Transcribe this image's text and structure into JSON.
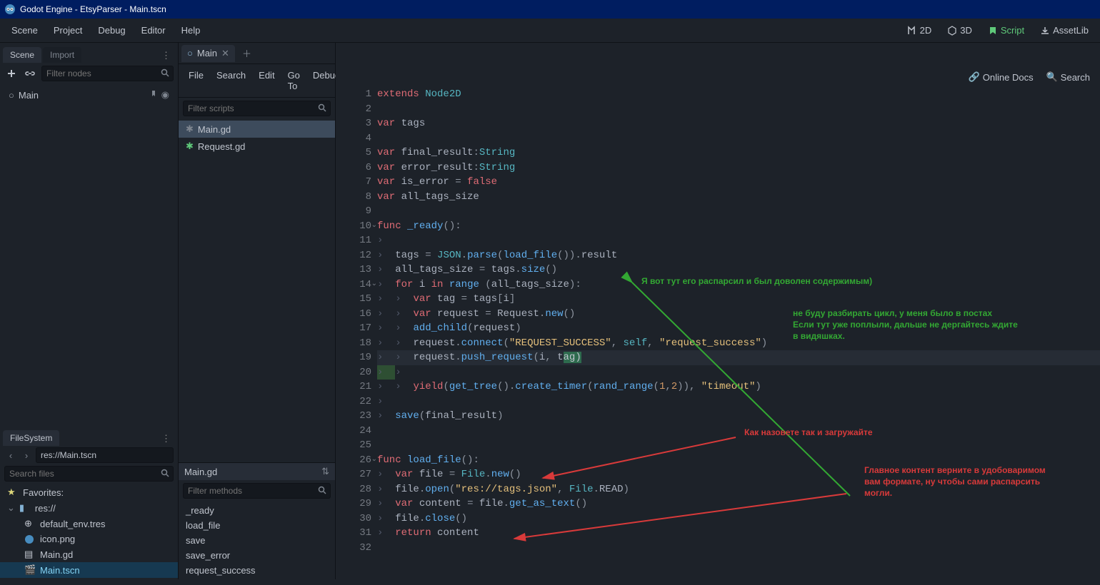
{
  "title": "Godot Engine - EtsyParser - Main.tscn",
  "topMenu": [
    "Scene",
    "Project",
    "Debug",
    "Editor",
    "Help"
  ],
  "workspaceSwitches": [
    {
      "icon": "2d",
      "label": "2D"
    },
    {
      "icon": "3d",
      "label": "3D"
    },
    {
      "icon": "script",
      "label": "Script",
      "active": true
    },
    {
      "icon": "assetlib",
      "label": "AssetLib"
    }
  ],
  "leftDock": {
    "tabs": [
      "Scene",
      "Import"
    ],
    "filterPlaceholder": "Filter nodes",
    "treeRoot": "Main"
  },
  "filesystem": {
    "title": "FileSystem",
    "path": "res://Main.tscn",
    "searchPlaceholder": "Search files",
    "favorites": "Favorites:",
    "root": "res://",
    "files": [
      "default_env.tres",
      "icon.png",
      "Main.gd",
      "Main.tscn"
    ]
  },
  "scriptTabs": {
    "open": "Main"
  },
  "scriptMenu": [
    "File",
    "Search",
    "Edit",
    "Go To",
    "Debug"
  ],
  "scriptMenuRight": [
    "Online Docs",
    "Search"
  ],
  "filterScriptsPlaceholder": "Filter scripts",
  "scripts": [
    "Main.gd",
    "Request.gd"
  ],
  "currentScript": "Main.gd",
  "filterMethodsPlaceholder": "Filter methods",
  "methods": [
    "_ready",
    "load_file",
    "save",
    "save_error",
    "request_success"
  ],
  "lines": 32,
  "annotations": {
    "a1": "Я вот тут его распарсил и был доволен содержимым)",
    "a2": "не буду разбирать цикл, у меня было в постах\nЕсли тут уже поплыли, дальше не дергайтесь ждите\nв видяшках.",
    "a3": "Как назовете так и загружайте",
    "a4": "Главное контент верните в удобоваримом\nвам формате, ну чтобы сами распарсить\nмогли."
  },
  "code": {
    "l1": [
      [
        "kw",
        "extends"
      ],
      [
        "va",
        " "
      ],
      [
        "ty",
        "Node2D"
      ]
    ],
    "l2": [],
    "l3": [
      [
        "kw",
        "var"
      ],
      [
        "va",
        " tags"
      ]
    ],
    "l4": [],
    "l5": [
      [
        "kw",
        "var"
      ],
      [
        "va",
        " final_result"
      ],
      [
        "op",
        ":"
      ],
      [
        "ty",
        "String"
      ]
    ],
    "l6": [
      [
        "kw",
        "var"
      ],
      [
        "va",
        " error_result"
      ],
      [
        "op",
        ":"
      ],
      [
        "ty",
        "String"
      ]
    ],
    "l7": [
      [
        "kw",
        "var"
      ],
      [
        "va",
        " is_error "
      ],
      [
        "op",
        "="
      ],
      [
        "va",
        " "
      ],
      [
        "kw",
        "false"
      ]
    ],
    "l8": [
      [
        "kw",
        "var"
      ],
      [
        "va",
        " all_tags_size"
      ]
    ],
    "l9": [],
    "l10": [
      [
        "kw",
        "func"
      ],
      [
        "va",
        " "
      ],
      [
        "fn",
        "_ready"
      ],
      [
        "op",
        "():"
      ]
    ],
    "l11": [
      [
        "tb",
        "›  "
      ]
    ],
    "l12": [
      [
        "tb",
        "›  "
      ],
      [
        "va",
        "tags "
      ],
      [
        "op",
        "="
      ],
      [
        "va",
        " "
      ],
      [
        "ty",
        "JSON"
      ],
      [
        "op",
        "."
      ],
      [
        "fn",
        "parse"
      ],
      [
        "op",
        "("
      ],
      [
        "fn",
        "load_file"
      ],
      [
        "op",
        "())."
      ],
      [
        "va",
        "result"
      ]
    ],
    "l13": [
      [
        "tb",
        "›  "
      ],
      [
        "va",
        "all_tags_size "
      ],
      [
        "op",
        "="
      ],
      [
        "va",
        " tags"
      ],
      [
        "op",
        "."
      ],
      [
        "fn",
        "size"
      ],
      [
        "op",
        "()"
      ]
    ],
    "l14": [
      [
        "tb",
        "›  "
      ],
      [
        "kw",
        "for"
      ],
      [
        "va",
        " i "
      ],
      [
        "kw",
        "in"
      ],
      [
        "va",
        " "
      ],
      [
        "fn",
        "range"
      ],
      [
        "va",
        " "
      ],
      [
        "op",
        "("
      ],
      [
        "va",
        "all_tags_size"
      ],
      [
        "op",
        "):"
      ]
    ],
    "l15": [
      [
        "tb",
        "›  "
      ],
      [
        "tb",
        "›  "
      ],
      [
        "kw",
        "var"
      ],
      [
        "va",
        " tag "
      ],
      [
        "op",
        "="
      ],
      [
        "va",
        " tags"
      ],
      [
        "op",
        "["
      ],
      [
        "va",
        "i"
      ],
      [
        "op",
        "]"
      ]
    ],
    "l16": [
      [
        "tb",
        "›  "
      ],
      [
        "tb",
        "›  "
      ],
      [
        "kw",
        "var"
      ],
      [
        "va",
        " request "
      ],
      [
        "op",
        "="
      ],
      [
        "va",
        " Request"
      ],
      [
        "op",
        "."
      ],
      [
        "fn",
        "new"
      ],
      [
        "op",
        "()"
      ]
    ],
    "l17": [
      [
        "tb",
        "›  "
      ],
      [
        "tb",
        "›  "
      ],
      [
        "fn",
        "add_child"
      ],
      [
        "op",
        "("
      ],
      [
        "va",
        "request"
      ],
      [
        "op",
        ")"
      ]
    ],
    "l18": [
      [
        "tb",
        "›  "
      ],
      [
        "tb",
        "›  "
      ],
      [
        "va",
        "request"
      ],
      [
        "op",
        "."
      ],
      [
        "fn",
        "connect"
      ],
      [
        "op",
        "("
      ],
      [
        "str",
        "\"REQUEST_SUCCESS\""
      ],
      [
        "op",
        ", "
      ],
      [
        "sl",
        "self"
      ],
      [
        "op",
        ", "
      ],
      [
        "str",
        "\"request_success\""
      ],
      [
        "op",
        ")"
      ]
    ],
    "l19": [
      [
        "tb",
        "›  "
      ],
      [
        "tb",
        "›  "
      ],
      [
        "va",
        "request"
      ],
      [
        "op",
        "."
      ],
      [
        "fn",
        "push_request"
      ],
      [
        "op",
        "("
      ],
      [
        "va",
        "i"
      ],
      [
        "op",
        ", "
      ],
      [
        "va",
        "t"
      ],
      [
        "hl",
        "ag)"
      ]
    ],
    "l20": [
      [
        "tbhl",
        "›  "
      ],
      [
        "tb",
        "›  "
      ]
    ],
    "l21": [
      [
        "tb",
        "›  "
      ],
      [
        "tb",
        "›  "
      ],
      [
        "kw",
        "yield"
      ],
      [
        "op",
        "("
      ],
      [
        "fn",
        "get_tree"
      ],
      [
        "op",
        "()."
      ],
      [
        "fn",
        "create_timer"
      ],
      [
        "op",
        "("
      ],
      [
        "fn",
        "rand_range"
      ],
      [
        "op",
        "("
      ],
      [
        "num",
        "1"
      ],
      [
        "op",
        ","
      ],
      [
        "num",
        "2"
      ],
      [
        "op",
        "))"
      ],
      [
        "op",
        ", "
      ],
      [
        "str",
        "\"timeout\""
      ],
      [
        "op",
        ")"
      ]
    ],
    "l22": [
      [
        "tb",
        "›  "
      ]
    ],
    "l23": [
      [
        "tb",
        "›  "
      ],
      [
        "fn",
        "save"
      ],
      [
        "op",
        "("
      ],
      [
        "va",
        "final_result"
      ],
      [
        "op",
        ")"
      ]
    ],
    "l24": [],
    "l25": [],
    "l26": [
      [
        "kw",
        "func"
      ],
      [
        "va",
        " "
      ],
      [
        "fn",
        "load_file"
      ],
      [
        "op",
        "():"
      ]
    ],
    "l27": [
      [
        "tb",
        "›  "
      ],
      [
        "kw",
        "var"
      ],
      [
        "va",
        " file "
      ],
      [
        "op",
        "="
      ],
      [
        "va",
        " "
      ],
      [
        "ty",
        "File"
      ],
      [
        "op",
        "."
      ],
      [
        "fn",
        "new"
      ],
      [
        "op",
        "()"
      ]
    ],
    "l28": [
      [
        "tb",
        "›  "
      ],
      [
        "va",
        "file"
      ],
      [
        "op",
        "."
      ],
      [
        "fn",
        "open"
      ],
      [
        "op",
        "("
      ],
      [
        "str",
        "\"res://tags.json\""
      ],
      [
        "op",
        ", "
      ],
      [
        "ty",
        "File"
      ],
      [
        "op",
        "."
      ],
      [
        "va",
        "READ"
      ],
      [
        "op",
        ")"
      ]
    ],
    "l29": [
      [
        "tb",
        "›  "
      ],
      [
        "kw",
        "var"
      ],
      [
        "va",
        " content "
      ],
      [
        "op",
        "="
      ],
      [
        "va",
        " file"
      ],
      [
        "op",
        "."
      ],
      [
        "fn",
        "get_as_text"
      ],
      [
        "op",
        "()"
      ]
    ],
    "l30": [
      [
        "tb",
        "›  "
      ],
      [
        "va",
        "file"
      ],
      [
        "op",
        "."
      ],
      [
        "fn",
        "close"
      ],
      [
        "op",
        "()"
      ]
    ],
    "l31": [
      [
        "tb",
        "›  "
      ],
      [
        "kw",
        "return"
      ],
      [
        "va",
        " content"
      ]
    ],
    "l32": []
  }
}
